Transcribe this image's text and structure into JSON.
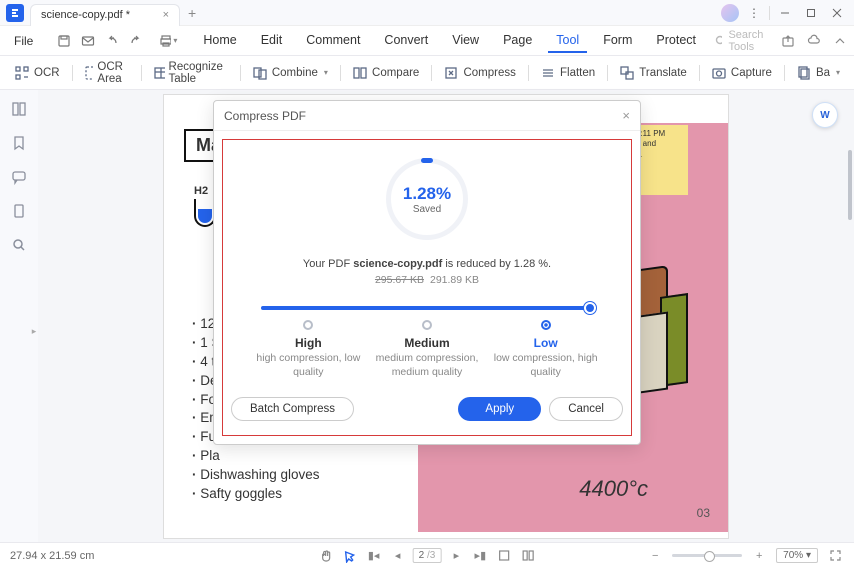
{
  "titlebar": {
    "tab_title": "science-copy.pdf *"
  },
  "menubar": {
    "file": "File",
    "items": [
      "Home",
      "Edit",
      "Comment",
      "Convert",
      "View",
      "Page",
      "Tool",
      "Form",
      "Protect"
    ],
    "active_index": 6,
    "search_placeholder": "Search Tools"
  },
  "toolbar": {
    "items": [
      "OCR",
      "OCR Area",
      "Recognize Table",
      "Combine",
      "Compare",
      "Compress",
      "Flatten",
      "Translate",
      "Capture",
      "Ba"
    ]
  },
  "document": {
    "title_strip": "Ma",
    "subheading": "H2",
    "note_time": "3:11 PM",
    "note_line1": "e and",
    "note_line2": "s.",
    "temperature": "4400°c",
    "page_number": "03",
    "list": [
      "12",
      "1 S",
      "4 t",
      "De",
      "Fo",
      "Em",
      "Fu",
      "Pla",
      "Dishwashing gloves",
      "Safty goggles"
    ]
  },
  "dialog": {
    "title": "Compress PDF",
    "saved_pct": "1.28%",
    "saved_label": "Saved",
    "summary_prefix": "Your PDF ",
    "summary_filename": "science-copy.pdf",
    "summary_suffix": "  is reduced by 1.28 %.",
    "size_old": "295.67 KB",
    "size_new": "291.89 KB",
    "options": [
      {
        "name": "High",
        "desc": "high compression, low quality"
      },
      {
        "name": "Medium",
        "desc": "medium compression, medium quality"
      },
      {
        "name": "Low",
        "desc": "low compression, high quality"
      }
    ],
    "selected_index": 2,
    "btn_batch": "Batch Compress",
    "btn_apply": "Apply",
    "btn_cancel": "Cancel"
  },
  "statusbar": {
    "page_size": "27.94 x 21.59 cm",
    "page_current": "2",
    "page_total": "/3",
    "zoom": "70%"
  }
}
